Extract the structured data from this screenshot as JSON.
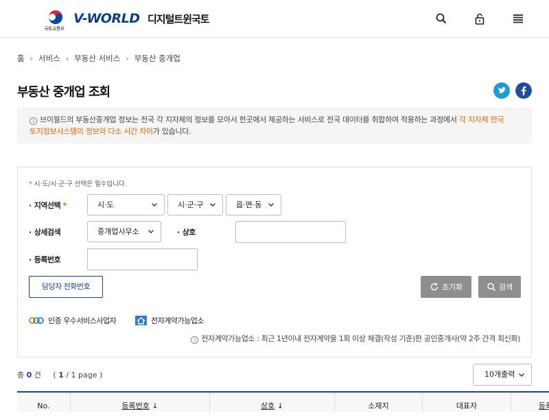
{
  "header": {
    "emblem_text": "국토교통부",
    "logo": "V-WORLD",
    "logo_sub": "디지털트윈국토",
    "icons": [
      "search-icon",
      "lock-icon",
      "menu-icon"
    ]
  },
  "breadcrumb": [
    "홈",
    "서비스",
    "부동산 서비스",
    "부동산 중개업"
  ],
  "page_title": "부동산 중개업 조회",
  "social": [
    "twitter-icon",
    "facebook-icon"
  ],
  "notice": {
    "part1": "브이월드의 부동산중개업 정보는 전국 각 지자체의 정보를 모아서 한곳에서 제공하는 서비스로 전국 데이터를 취합하여 적용하는 과정에서 ",
    "highlight1": "각 지자체 한국",
    "highlight2": "토지정보시스템의 정보와 다소 시간 차이",
    "part2": "가 있습니다."
  },
  "search": {
    "required_note": "시·도/시·군·구 선택은 필수입니다.",
    "region_label": "지역선택",
    "sido": "시·도",
    "sigungu": "시·군·구",
    "eupmyeondong": "읍·면·동",
    "detail_label": "상세검색",
    "detail_select": "중개업사무소",
    "name_label": "상호",
    "name_value": "",
    "regno_label": "등록번호",
    "regno_value": "",
    "contact_button": "담당자 전화번호",
    "reset_button": "초기화",
    "search_button": "검색",
    "legend_certified": "인증 우수서비스사업자",
    "legend_econtract": "전자계약가능업소",
    "econtract_note": "전자계약가능업소 : 최근 1년이내 전자계약을 1회 이상 체결(작성 기준)한 공인중개사(약 2주 간격 최신화)"
  },
  "results": {
    "total_prefix": "총",
    "total_count": "0",
    "total_suffix": "건",
    "page_open": "(",
    "page_current": "1",
    "page_rest": "/ 1 page )",
    "per_page": "10개출력"
  },
  "table": {
    "columns": [
      "No.",
      "등록번호",
      "상호",
      "소재지",
      "대표자",
      "등록"
    ]
  },
  "colors": {
    "brand_blue": "#1c3f8f",
    "accent_orange": "#e8680c",
    "button_gray": "#8e8e8e"
  }
}
